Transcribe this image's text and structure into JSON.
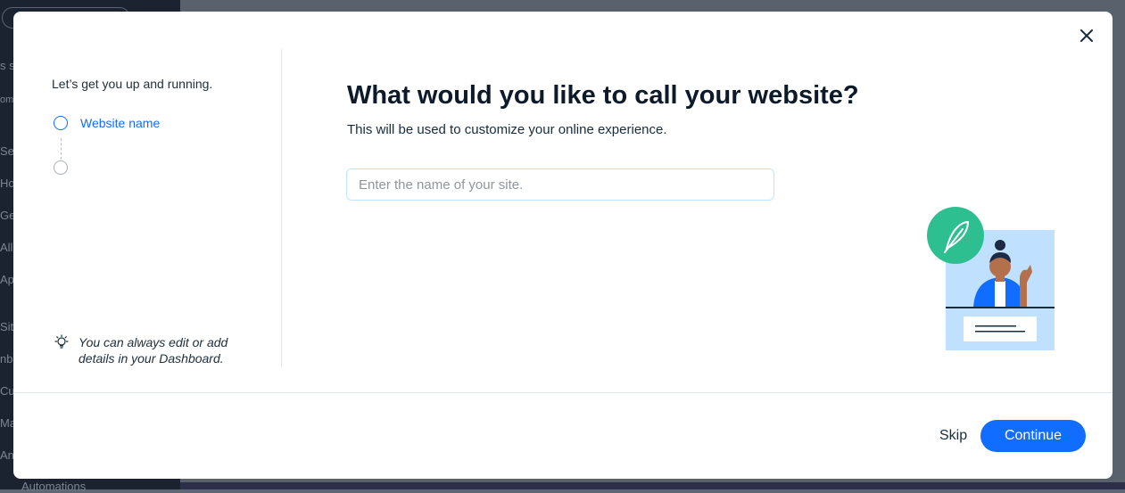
{
  "background": {
    "sidebar_items": [
      "s se",
      "om",
      "Set",
      "Ho",
      "Ge",
      "All",
      "Ap",
      "Site",
      "nb",
      "Cu",
      "Ma",
      "Ana",
      "Automations"
    ]
  },
  "modal": {
    "left_panel": {
      "intro": "Let’s get you up and running.",
      "steps": [
        {
          "label": "Website name",
          "state": "active"
        },
        {
          "label": "",
          "state": "inactive"
        }
      ],
      "tip": "You can always edit or add details in your Dashboard."
    },
    "main": {
      "title": "What would you like to call your website?",
      "subtitle": "This will be used to customize your online experience.",
      "site_name_input": {
        "value": "",
        "placeholder": "Enter the name of your site."
      }
    },
    "footer": {
      "skip_label": "Skip",
      "continue_label": "Continue"
    },
    "colors": {
      "accent": "#116dff",
      "illustration_green": "#2ebf91",
      "illustration_panel": "#bfe0ff"
    },
    "icons": [
      "close-icon",
      "lightbulb-icon",
      "feather-icon"
    ]
  }
}
